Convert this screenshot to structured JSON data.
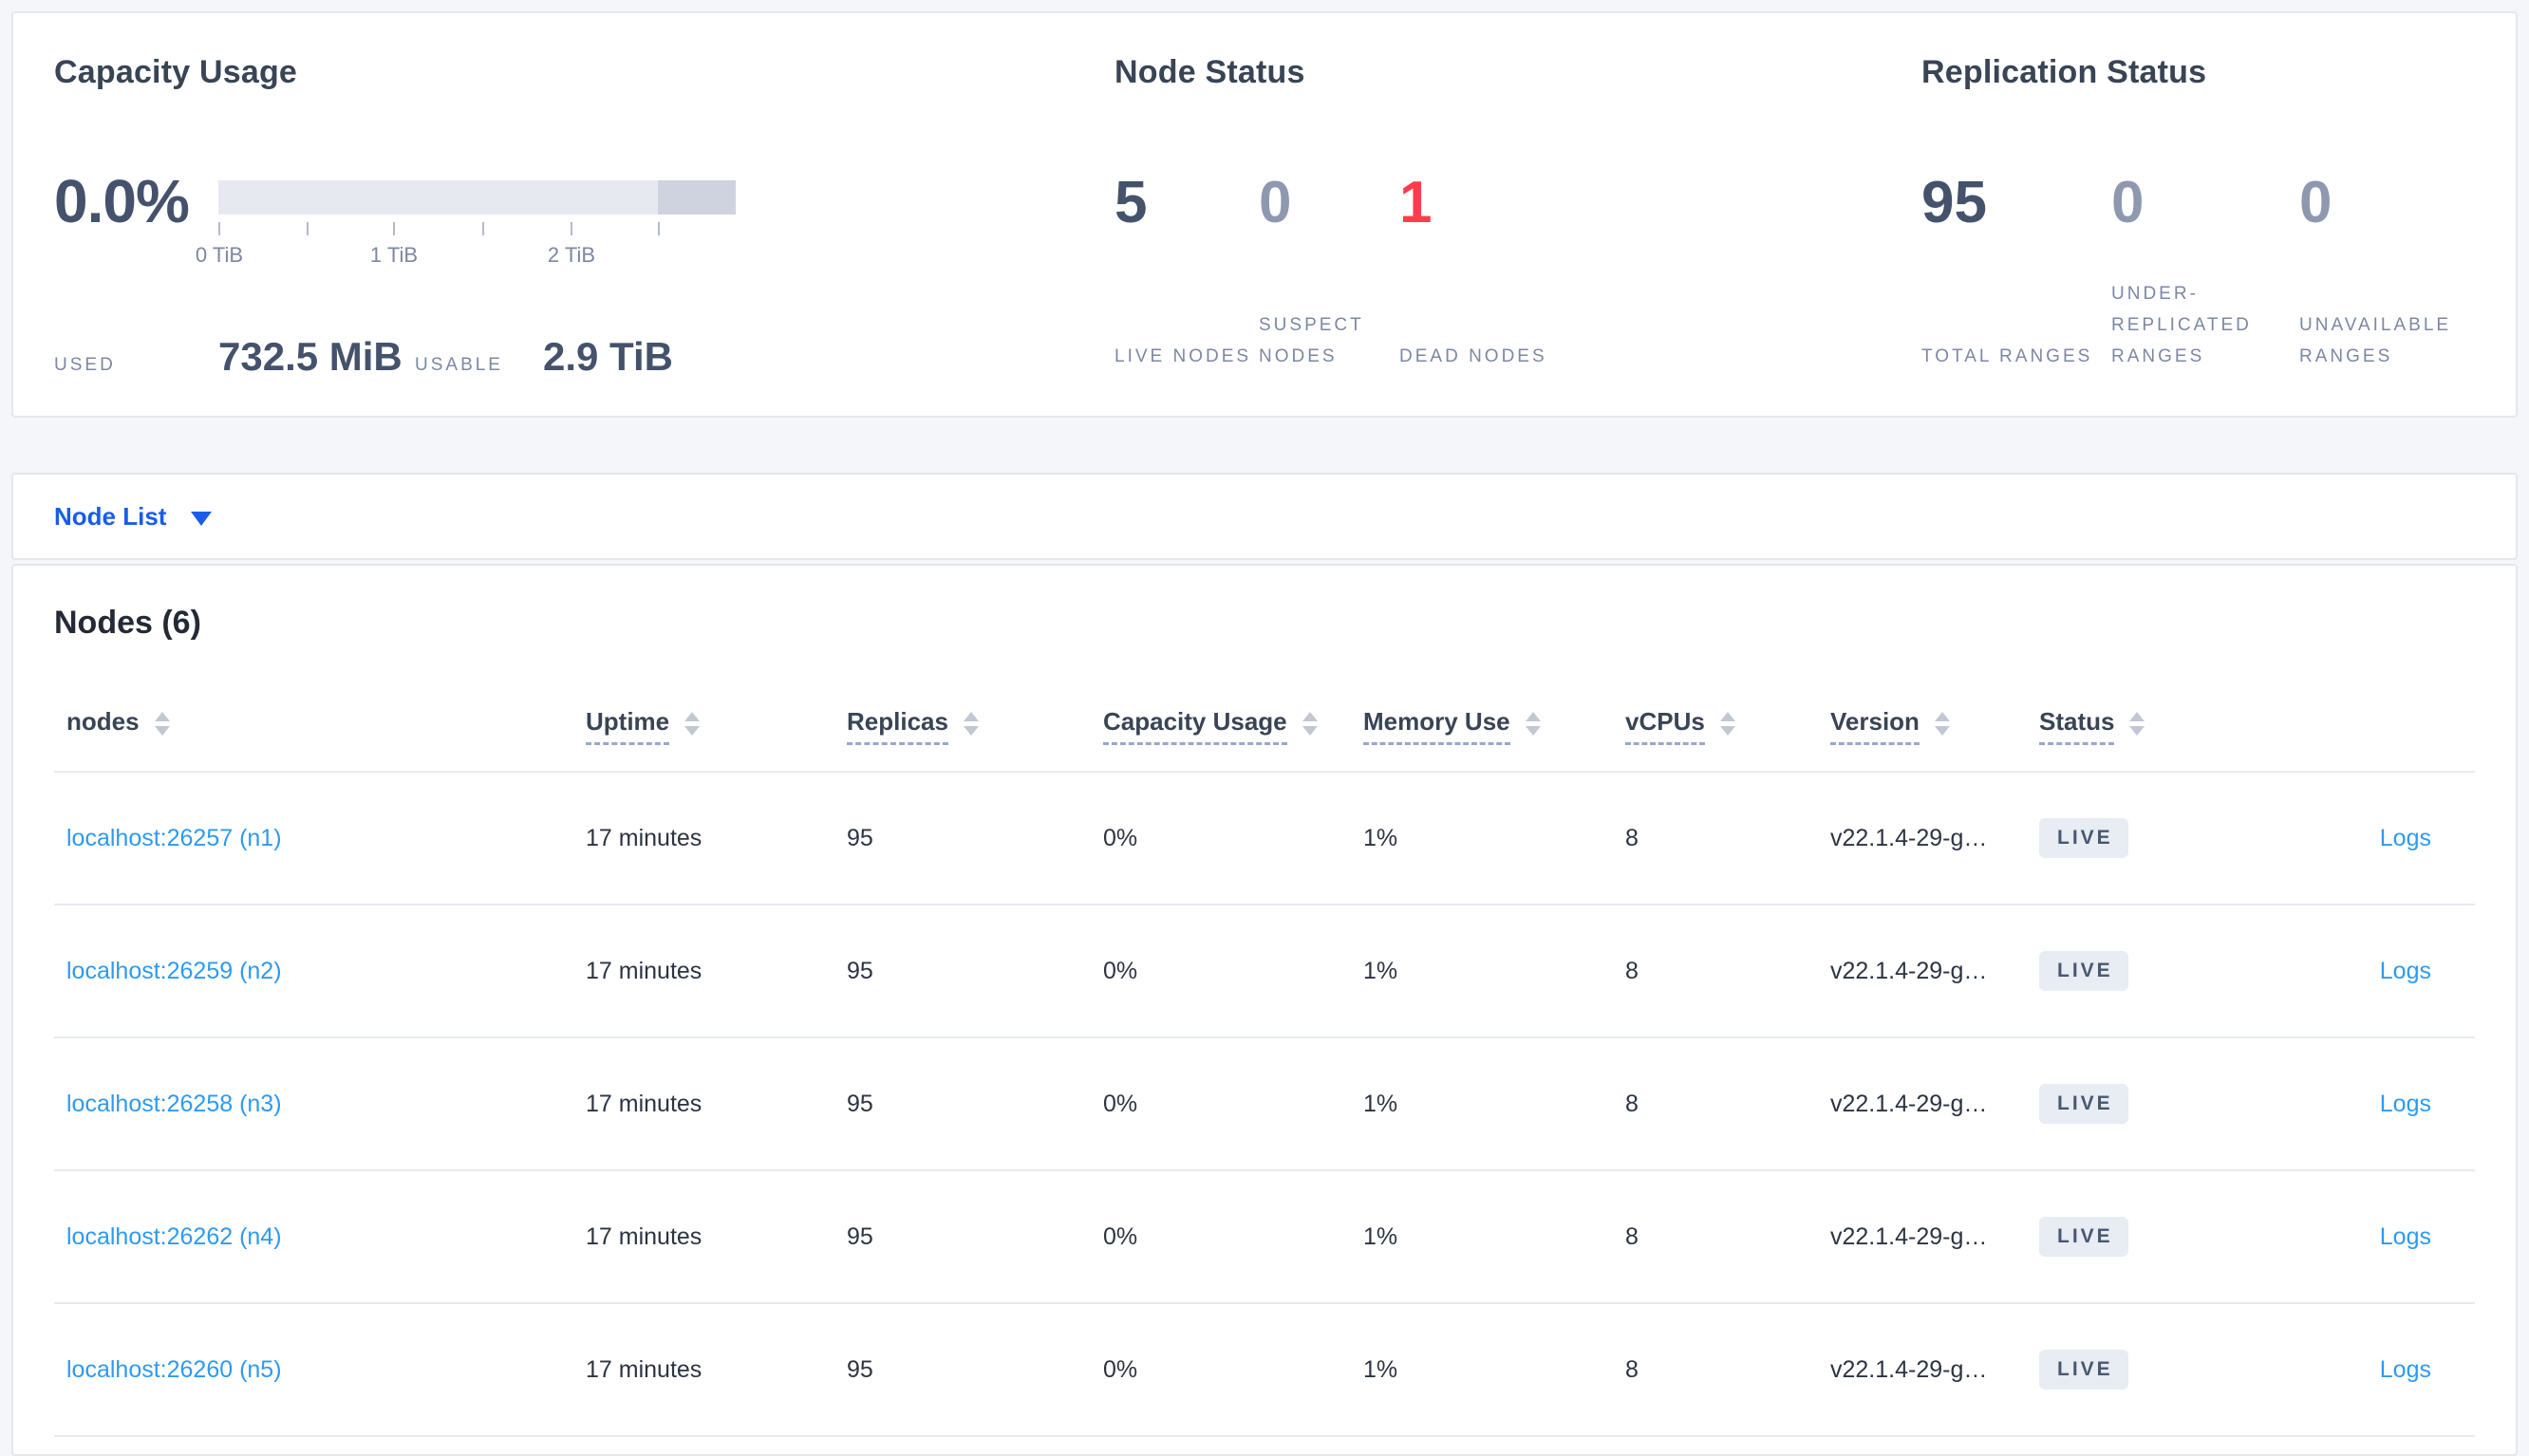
{
  "summary": {
    "capacity": {
      "title": "Capacity Usage",
      "percent": "0.0%",
      "ticks": [
        "0 TiB",
        "1 TiB",
        "2 TiB"
      ],
      "used_label": "USED",
      "used_value": "732.5 MiB",
      "usable_label": "USABLE",
      "usable_value": "2.9 TiB",
      "bar_color": "#e7e9f1",
      "bar_dark_color": "#cfd3e0"
    },
    "node_status": {
      "title": "Node Status",
      "stats": [
        {
          "value": "5",
          "label": "LIVE NODES",
          "color": "#44526b"
        },
        {
          "value": "0",
          "label": "SUSPECT NODES",
          "color": "#8e99b0"
        },
        {
          "value": "1",
          "label": "DEAD NODES",
          "color": "#ff3b4e"
        }
      ]
    },
    "replication": {
      "title": "Replication Status",
      "stats": [
        {
          "value": "95",
          "label": "TOTAL RANGES",
          "color": "#44526b"
        },
        {
          "value": "0",
          "label": "UNDER-REPLICATED RANGES",
          "color": "#8e99b0"
        },
        {
          "value": "0",
          "label": "UNAVAILABLE RANGES",
          "color": "#8e99b0"
        }
      ]
    }
  },
  "view_selector": {
    "label": "Node List"
  },
  "nodes_section": {
    "title": "Nodes (6)"
  },
  "table": {
    "headers": [
      "nodes",
      "Uptime",
      "Replicas",
      "Capacity Usage",
      "Memory Use",
      "vCPUs",
      "Version",
      "Status"
    ],
    "rows": [
      {
        "address": "localhost:26257 (n1)",
        "uptime": "17 minutes",
        "replicas": "95",
        "capacity": "0%",
        "memory": "1%",
        "vcpus": "8",
        "version": "v22.1.4-29-g…",
        "status": "LIVE",
        "logs": "Logs"
      },
      {
        "address": "localhost:26259 (n2)",
        "uptime": "17 minutes",
        "replicas": "95",
        "capacity": "0%",
        "memory": "1%",
        "vcpus": "8",
        "version": "v22.1.4-29-g…",
        "status": "LIVE",
        "logs": "Logs"
      },
      {
        "address": "localhost:26258 (n3)",
        "uptime": "17 minutes",
        "replicas": "95",
        "capacity": "0%",
        "memory": "1%",
        "vcpus": "8",
        "version": "v22.1.4-29-g…",
        "status": "LIVE",
        "logs": "Logs"
      },
      {
        "address": "localhost:26262 (n4)",
        "uptime": "17 minutes",
        "replicas": "95",
        "capacity": "0%",
        "memory": "1%",
        "vcpus": "8",
        "version": "v22.1.4-29-g…",
        "status": "LIVE",
        "logs": "Logs"
      },
      {
        "address": "localhost:26260 (n5)",
        "uptime": "17 minutes",
        "replicas": "95",
        "capacity": "0%",
        "memory": "1%",
        "vcpus": "8",
        "version": "v22.1.4-29-g…",
        "status": "LIVE",
        "logs": "Logs"
      }
    ]
  },
  "colors": {
    "link_blue": "#2d9af2",
    "selector_blue": "#1a5cea",
    "dead_red": "#ff3b4e",
    "primary_number": "#44526b",
    "muted_number": "#8e99b0"
  }
}
